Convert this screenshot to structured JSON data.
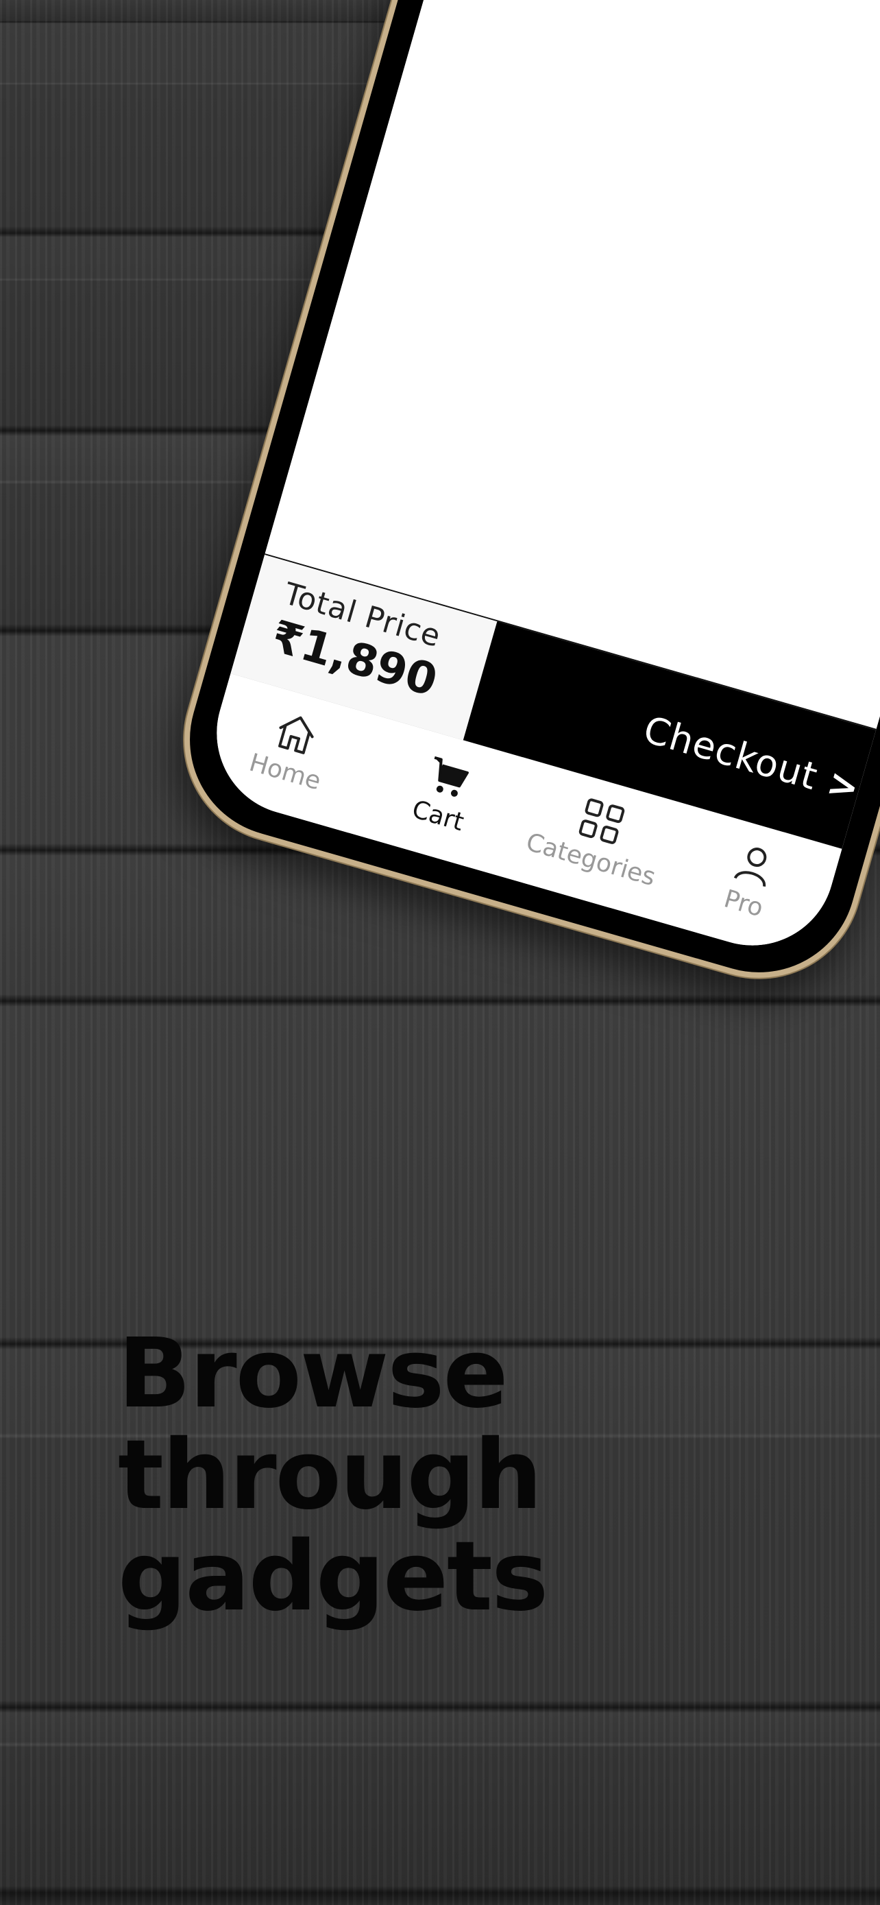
{
  "cart_screen": {
    "total_label": "Total Price",
    "total_value": "₹1,890",
    "checkout_label": "Checkout",
    "checkout_chevron": ">"
  },
  "bottom_nav": {
    "items": [
      {
        "label": "Home",
        "icon": "home-icon",
        "active": false
      },
      {
        "label": "Cart",
        "icon": "cart-icon",
        "active": true
      },
      {
        "label": "Categories",
        "icon": "categories-icon",
        "active": false
      },
      {
        "label": "Pro",
        "icon": "profile-icon",
        "active": false
      }
    ]
  },
  "headline": {
    "line1": "Browse",
    "line2": "through",
    "line3": "gadgets"
  },
  "colors": {
    "frame": "#c7b08a",
    "checkout_bg": "#000000",
    "headline": "#060606"
  }
}
